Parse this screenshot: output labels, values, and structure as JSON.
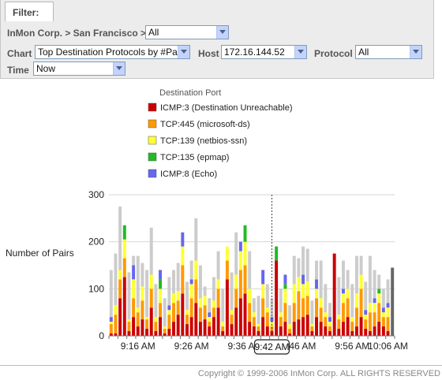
{
  "filter": {
    "tab_label": "Filter:",
    "breadcrumb": "InMon Corp. > San Francisco >",
    "location_select": "All",
    "chart_label": "Chart",
    "chart_select": "Top Destination Protocols by #Pairs",
    "host_label": "Host",
    "host_select": "172.16.144.52",
    "protocol_label": "Protocol",
    "protocol_select": "All",
    "time_label": "Time",
    "time_select": "Now"
  },
  "chart_data": {
    "type": "bar",
    "stacked": true,
    "legend_title": "Destination Port",
    "ylabel": "Number of Pairs",
    "ylim": [
      0,
      300
    ],
    "yticks": [
      0,
      100,
      200,
      300
    ],
    "xticks": [
      {
        "index": 6,
        "label": "9:16 AM"
      },
      {
        "index": 18,
        "label": "9:26 AM"
      },
      {
        "index": 30,
        "label": "9:36 AM"
      },
      {
        "index": 42,
        "label": "9:46 AM"
      },
      {
        "index": 54,
        "label": "9:56 AM"
      },
      {
        "index": 62,
        "label": "10:06 AM"
      }
    ],
    "cursor": {
      "index": 36,
      "label": "9:42 AM"
    },
    "series": [
      {
        "name": "ICMP:3 (Destination Unreachable)",
        "color": "#cc0000",
        "values": [
          5,
          5,
          80,
          125,
          10,
          40,
          20,
          35,
          15,
          60,
          10,
          40,
          5,
          15,
          30,
          45,
          90,
          25,
          40,
          70,
          30,
          35,
          20,
          40,
          60,
          10,
          120,
          25,
          60,
          80,
          90,
          30,
          20,
          10,
          40,
          20,
          10,
          160,
          20,
          30,
          5,
          30,
          35,
          40,
          45,
          10,
          40,
          30,
          20,
          10,
          175,
          15,
          30,
          40,
          10,
          20,
          40,
          15,
          10,
          20,
          30,
          20,
          10,
          0
        ]
      },
      {
        "name": "TCP:445 (microsoft-ds)",
        "color": "#ff9900",
        "values": [
          20,
          40,
          40,
          40,
          20,
          40,
          30,
          40,
          20,
          40,
          20,
          30,
          10,
          30,
          40,
          30,
          60,
          20,
          40,
          50,
          30,
          30,
          10,
          20,
          40,
          10,
          40,
          20,
          40,
          60,
          60,
          40,
          20,
          10,
          40,
          30,
          10,
          0,
          20,
          40,
          10,
          40,
          60,
          40,
          40,
          10,
          40,
          30,
          20,
          10,
          0,
          20,
          40,
          40,
          20,
          40,
          60,
          20,
          40,
          30,
          40,
          20,
          30,
          0
        ]
      },
      {
        "name": "TCP:139 (netbios-ssn)",
        "color": "#ffff33",
        "values": [
          5,
          20,
          20,
          40,
          5,
          40,
          10,
          30,
          5,
          30,
          10,
          30,
          5,
          10,
          20,
          20,
          40,
          10,
          30,
          40,
          20,
          20,
          10,
          15,
          20,
          10,
          30,
          10,
          30,
          40,
          50,
          30,
          10,
          5,
          30,
          10,
          10,
          0,
          10,
          30,
          10,
          40,
          30,
          30,
          30,
          5,
          20,
          20,
          10,
          10,
          0,
          10,
          20,
          20,
          10,
          30,
          30,
          10,
          20,
          20,
          20,
          10,
          20,
          0
        ]
      },
      {
        "name": "TCP:135 (epmap)",
        "color": "#22bb22",
        "values": [
          0,
          0,
          0,
          30,
          0,
          0,
          0,
          0,
          0,
          0,
          0,
          20,
          0,
          0,
          0,
          0,
          0,
          0,
          0,
          0,
          0,
          0,
          0,
          0,
          0,
          0,
          0,
          0,
          0,
          0,
          35,
          0,
          0,
          0,
          0,
          0,
          0,
          30,
          0,
          10,
          0,
          0,
          0,
          0,
          0,
          0,
          0,
          0,
          0,
          0,
          0,
          0,
          0,
          0,
          0,
          0,
          0,
          0,
          0,
          0,
          10,
          0,
          0,
          0
        ]
      },
      {
        "name": "ICMP:8 (Echo)",
        "color": "#6666ee",
        "values": [
          10,
          0,
          0,
          0,
          0,
          30,
          0,
          0,
          0,
          0,
          0,
          20,
          0,
          10,
          0,
          0,
          30,
          0,
          10,
          0,
          0,
          0,
          10,
          0,
          0,
          0,
          0,
          0,
          0,
          20,
          0,
          0,
          0,
          0,
          30,
          0,
          10,
          0,
          0,
          20,
          0,
          0,
          0,
          20,
          0,
          0,
          20,
          0,
          0,
          10,
          0,
          0,
          10,
          0,
          0,
          0,
          0,
          10,
          0,
          10,
          0,
          10,
          10,
          0
        ]
      },
      {
        "name": "",
        "color": "#cccccc",
        "values": [
          100,
          110,
          135,
          0,
          100,
          20,
          110,
          50,
          100,
          100,
          70,
          0,
          60,
          60,
          50,
          60,
          0,
          60,
          40,
          90,
          70,
          20,
          30,
          50,
          60,
          70,
          0,
          80,
          90,
          0,
          0,
          80,
          30,
          60,
          0,
          50,
          40,
          0,
          50,
          0,
          40,
          60,
          40,
          60,
          70,
          50,
          40,
          80,
          60,
          30,
          0,
          80,
          60,
          40,
          70,
          80,
          40,
          60,
          100,
          60,
          30,
          40,
          50,
          0
        ]
      },
      {
        "name": "",
        "color": "#666666",
        "values": [
          0,
          0,
          0,
          0,
          0,
          0,
          0,
          0,
          0,
          0,
          0,
          0,
          0,
          0,
          0,
          0,
          0,
          0,
          0,
          0,
          0,
          0,
          0,
          0,
          0,
          0,
          0,
          0,
          0,
          0,
          0,
          0,
          0,
          0,
          0,
          0,
          0,
          0,
          0,
          0,
          0,
          0,
          0,
          0,
          0,
          0,
          0,
          0,
          0,
          0,
          0,
          0,
          0,
          0,
          0,
          0,
          0,
          0,
          0,
          0,
          0,
          0,
          0,
          145
        ]
      }
    ]
  },
  "footer": {
    "copyright": "Copyright © 1999-2006 InMon Corp. ALL RIGHTS RESERVED"
  }
}
